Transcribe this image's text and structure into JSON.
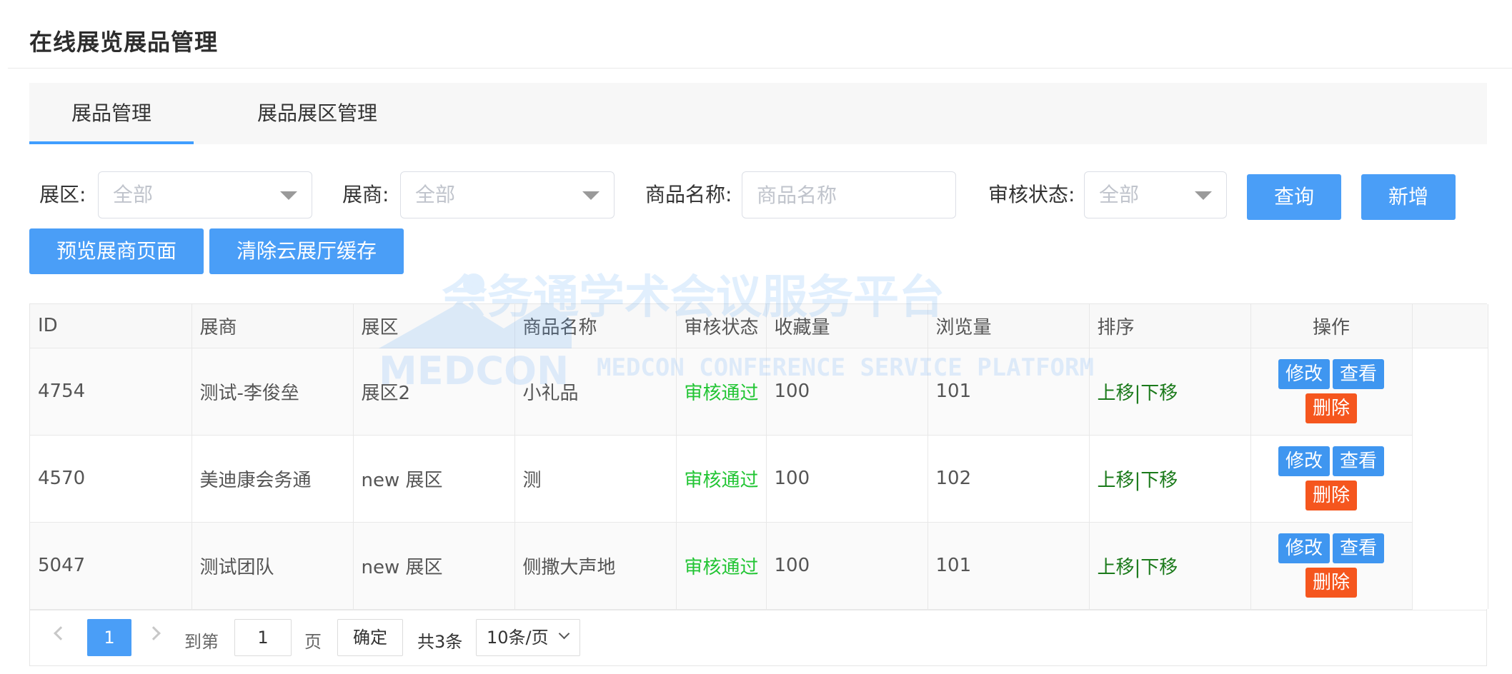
{
  "page": {
    "title": "在线展览展品管理"
  },
  "tabs": [
    {
      "label": "展品管理",
      "active": true
    },
    {
      "label": "展品展区管理",
      "active": false
    }
  ],
  "filters": {
    "zone_label": "展区:",
    "zone_value": "全部",
    "exhibitor_label": "展商:",
    "exhibitor_value": "全部",
    "product_label": "商品名称:",
    "product_placeholder": "商品名称",
    "status_label": "审核状态:",
    "status_value": "全部"
  },
  "buttons": {
    "query": "查询",
    "add": "新增",
    "preview": "预览展商页面",
    "clear_cache": "清除云展厅缓存"
  },
  "table": {
    "headers": [
      "ID",
      "展商",
      "展区",
      "商品名称",
      "审核状态",
      "收藏量",
      "浏览量",
      "排序",
      "操作"
    ],
    "rows": [
      {
        "id": "4754",
        "exhibitor": "测试-李俊垒",
        "zone": "展区2",
        "product": "小礼品",
        "status": "审核通过",
        "favorites": "100",
        "views": "101"
      },
      {
        "id": "4570",
        "exhibitor": "美迪康会务通",
        "zone": "new 展区",
        "product": "测",
        "status": "审核通过",
        "favorites": "100",
        "views": "102"
      },
      {
        "id": "5047",
        "exhibitor": "测试团队",
        "zone": "new 展区",
        "product": "侧撒大声地",
        "status": "审核通过",
        "favorites": "100",
        "views": "101"
      }
    ],
    "sort_up": "上移",
    "sort_sep": "|",
    "sort_down": "下移",
    "op_edit": "修改",
    "op_view": "查看",
    "op_delete": "删除"
  },
  "pagination": {
    "current_page": "1",
    "goto_label": "到第",
    "goto_value": "1",
    "page_unit": "页",
    "confirm": "确定",
    "total": "共3条",
    "page_size": "10条/页"
  },
  "watermark": {
    "title": "会务通学术会议服务平台",
    "logo_text": "MEDCON",
    "subtitle": "MEDCON CONFERENCE SERVICE PLATFORM"
  },
  "colors": {
    "primary": "#4a9ef7",
    "danger": "#f5561e",
    "status_ok": "#22c534",
    "sort_link": "#1b7a1b"
  }
}
